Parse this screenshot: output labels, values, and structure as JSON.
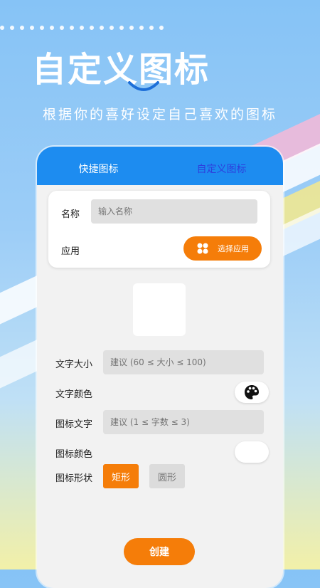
{
  "hero": {
    "title": "自定义图标",
    "subtitle": "根据你的喜好设定自己喜欢的图标"
  },
  "tabs": [
    {
      "label": "快捷图标",
      "active": false
    },
    {
      "label": "自定义图标",
      "active": true
    }
  ],
  "form": {
    "name_label": "名称",
    "name_placeholder": "输入名称",
    "app_label": "应用",
    "select_app_button": "选择应用",
    "text_size_label": "文字大小",
    "text_size_placeholder": "建议 (60 ≤ 大小 ≤ 100)",
    "text_color_label": "文字颜色",
    "icon_text_label": "图标文字",
    "icon_text_placeholder": "建议 (1 ≤ 字数 ≤ 3)",
    "icon_color_label": "图标颜色",
    "icon_shape_label": "图标形状",
    "shape_options": [
      "矩形",
      "圆形"
    ],
    "selected_shape": "矩形",
    "create_button": "创建"
  },
  "colors": {
    "accent_orange": "#f57d09",
    "tab_bar_blue": "#1d8cf0",
    "active_tab_text": "#2d3fdd"
  },
  "icons": [
    "smile-icon",
    "grid-apps-icon",
    "palette-icon"
  ]
}
